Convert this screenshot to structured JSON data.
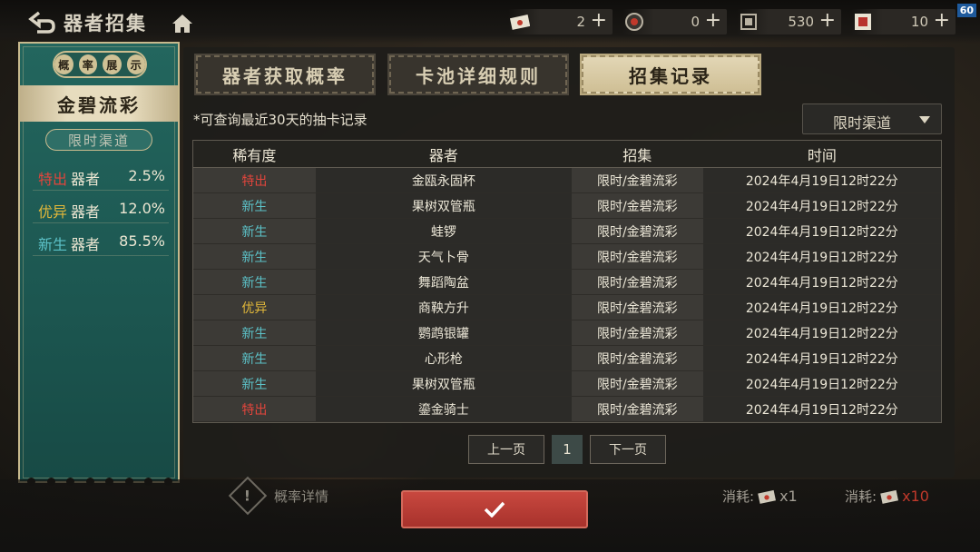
{
  "header": {
    "title": "器者招集",
    "fps": "60",
    "resources": [
      {
        "icon": "envelope-icon",
        "value": "2"
      },
      {
        "icon": "token-icon",
        "value": "0"
      },
      {
        "icon": "scroll-icon",
        "value": "530"
      },
      {
        "icon": "red-seal-icon",
        "value": "10"
      }
    ]
  },
  "left_panel": {
    "tab_chars": [
      "概",
      "率",
      "展",
      "示"
    ],
    "pool_name": "金碧流彩",
    "channel": "限时渠道",
    "rates": [
      {
        "level": "特出",
        "label": "器者",
        "percent": "2.5%",
        "color": "#e2453c"
      },
      {
        "level": "优异",
        "label": "器者",
        "percent": "12.0%",
        "color": "#e2b83a"
      },
      {
        "level": "新生",
        "label": "器者",
        "percent": "85.5%",
        "color": "#5cc2c8"
      }
    ]
  },
  "main": {
    "tabs": [
      "器者获取概率",
      "卡池详细规则",
      "招集记录"
    ],
    "active_tab": 2,
    "note": "*可查询最近30天的抽卡记录",
    "dropdown_value": "限时渠道",
    "columns": [
      "稀有度",
      "器者",
      "招集",
      "时间"
    ],
    "rows": [
      {
        "rarity": "特出",
        "name": "金瓯永固杯",
        "pool": "限时/金碧流彩",
        "time": "2024年4月19日12时22分"
      },
      {
        "rarity": "新生",
        "name": "果树双管瓶",
        "pool": "限时/金碧流彩",
        "time": "2024年4月19日12时22分"
      },
      {
        "rarity": "新生",
        "name": "蛙锣",
        "pool": "限时/金碧流彩",
        "time": "2024年4月19日12时22分"
      },
      {
        "rarity": "新生",
        "name": "天气卜骨",
        "pool": "限时/金碧流彩",
        "time": "2024年4月19日12时22分"
      },
      {
        "rarity": "新生",
        "name": "舞蹈陶盆",
        "pool": "限时/金碧流彩",
        "time": "2024年4月19日12时22分"
      },
      {
        "rarity": "优异",
        "name": "商鞅方升",
        "pool": "限时/金碧流彩",
        "time": "2024年4月19日12时22分"
      },
      {
        "rarity": "新生",
        "name": "鹦鹉银罐",
        "pool": "限时/金碧流彩",
        "time": "2024年4月19日12时22分"
      },
      {
        "rarity": "新生",
        "name": "心形枪",
        "pool": "限时/金碧流彩",
        "time": "2024年4月19日12时22分"
      },
      {
        "rarity": "新生",
        "name": "果树双管瓶",
        "pool": "限时/金碧流彩",
        "time": "2024年4月19日12时22分"
      },
      {
        "rarity": "特出",
        "name": "鎏金骑士",
        "pool": "限时/金碧流彩",
        "time": "2024年4月19日12时22分"
      }
    ],
    "pager": {
      "prev": "上一页",
      "page": "1",
      "next": "下一页"
    }
  },
  "bottom": {
    "prob_detail_icon": "!",
    "prob_detail": "概率详情",
    "cost_left": {
      "label": "消耗:",
      "count": "x1"
    },
    "cost_right": {
      "label": "消耗:",
      "count": "x10"
    }
  },
  "rarity_colors": {
    "特出": "#e2453c",
    "优异": "#e2b83a",
    "新生": "#5cc2c8"
  }
}
